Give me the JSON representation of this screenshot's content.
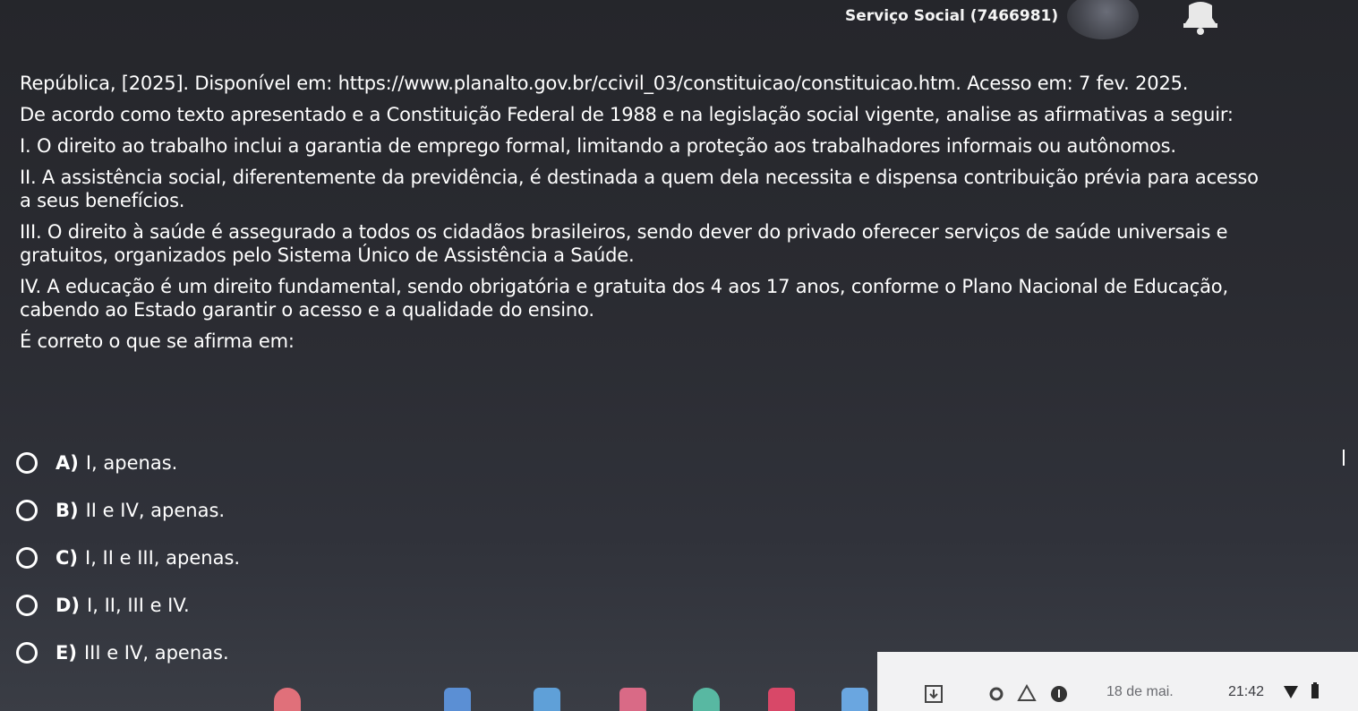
{
  "header": {
    "course_title": "Serviço Social (7466981)"
  },
  "question": {
    "reference": "República, [2025]. Disponível em: https://www.planalto.gov.br/ccivil_03/constituicao/constituicao.htm. Acesso em: 7 fev. 2025.",
    "prompt": "De acordo como texto apresentado e a Constituição Federal de 1988 e na legislação social vigente, analise as afirmativas a seguir:",
    "statements": [
      "I. O direito ao trabalho inclui a garantia de emprego formal, limitando a proteção aos trabalhadores informais ou autônomos.",
      "II. A assistência social, diferentemente da previdência, é destinada a quem dela necessita e dispensa contribuição prévia para acesso a seus benefícios.",
      "III. O direito à saúde é assegurado a todos os cidadãos brasileiros, sendo dever do privado oferecer serviços de saúde universais e gratuitos, organizados pelo Sistema Único de Assistência a Saúde.",
      "IV. A educação é um direito fundamental, sendo obrigatória e gratuita dos 4 aos 17 anos, conforme o Plano Nacional de Educação, cabendo ao Estado garantir o acesso e a qualidade do ensino."
    ],
    "ask": "É correto o que se afirma em:",
    "options": [
      {
        "letter": "A)",
        "text": "I, apenas."
      },
      {
        "letter": "B)",
        "text": "II e IV, apenas."
      },
      {
        "letter": "C)",
        "text": "I, II e III, apenas."
      },
      {
        "letter": "D)",
        "text": "I, II, III e IV."
      },
      {
        "letter": "E)",
        "text": "III e IV, apenas."
      }
    ]
  },
  "taskbar": {
    "date": "18 de mai.",
    "time": "21:42"
  },
  "colors": {
    "background": "#2a2b31",
    "text": "#ffffff",
    "taskbar_tray": "#f2f2f3"
  },
  "icons": [
    "avatar",
    "bell-icon",
    "download-icon",
    "settings-icon",
    "warning-icon",
    "info-icon",
    "wifi-icon",
    "battery-icon"
  ]
}
